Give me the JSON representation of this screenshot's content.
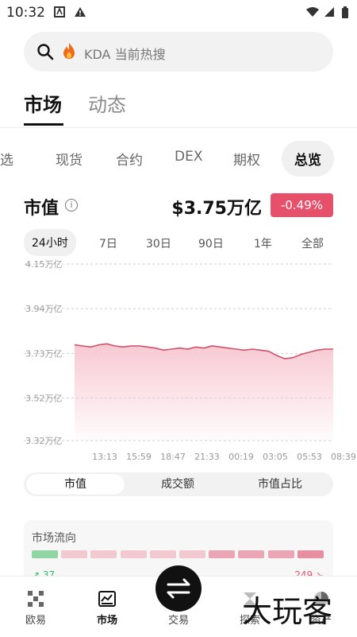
{
  "status": {
    "time": "10:32"
  },
  "search": {
    "placeholder": "KDA 当前热搜"
  },
  "top_tabs": [
    {
      "label": "市场",
      "active": true
    },
    {
      "label": "动态",
      "active": false
    }
  ],
  "sub_tabs": [
    {
      "label": "自选"
    },
    {
      "label": "现货"
    },
    {
      "label": "合约"
    },
    {
      "label": "DEX"
    },
    {
      "label": "期权"
    },
    {
      "label": "总览",
      "selected": true
    }
  ],
  "market_cap": {
    "title": "市值",
    "value": "$3.75万亿",
    "change": "-0.49%"
  },
  "ranges": [
    {
      "label": "24小时",
      "selected": true
    },
    {
      "label": "7日"
    },
    {
      "label": "30日"
    },
    {
      "label": "90日"
    },
    {
      "label": "1年"
    },
    {
      "label": "全部"
    }
  ],
  "chart_data": {
    "type": "area",
    "y_ticks": [
      "4.15万亿",
      "3.94万亿",
      "3.73万亿",
      "3.52万亿",
      "3.32万亿"
    ],
    "y_tick_values": [
      4.15,
      3.94,
      3.73,
      3.52,
      3.32
    ],
    "x_ticks": [
      "13:13",
      "15:59",
      "18:47",
      "21:33",
      "00:19",
      "03:05",
      "05:53",
      "08:39"
    ],
    "ylim": [
      3.32,
      4.15
    ],
    "values": [
      3.77,
      3.765,
      3.76,
      3.77,
      3.775,
      3.765,
      3.76,
      3.765,
      3.765,
      3.76,
      3.755,
      3.745,
      3.75,
      3.755,
      3.75,
      3.76,
      3.755,
      3.765,
      3.76,
      3.755,
      3.75,
      3.745,
      3.75,
      3.745,
      3.74,
      3.72,
      3.705,
      3.71,
      3.725,
      3.735,
      3.745,
      3.75,
      3.75
    ],
    "line_color": "#d2506a",
    "fill_color": "#f7c6d0",
    "grid": true
  },
  "segments": [
    {
      "label": "市值",
      "selected": true
    },
    {
      "label": "成交额"
    },
    {
      "label": "市值占比"
    }
  ],
  "flow": {
    "title": "市场流向",
    "up": "↗ 37",
    "down": "249 ↘"
  },
  "nav": [
    {
      "label": "欧易"
    },
    {
      "label": "市场",
      "active": true
    },
    {
      "label": "交易"
    },
    {
      "label": "探索"
    },
    {
      "label": "资产"
    }
  ],
  "watermark": "大玩客"
}
